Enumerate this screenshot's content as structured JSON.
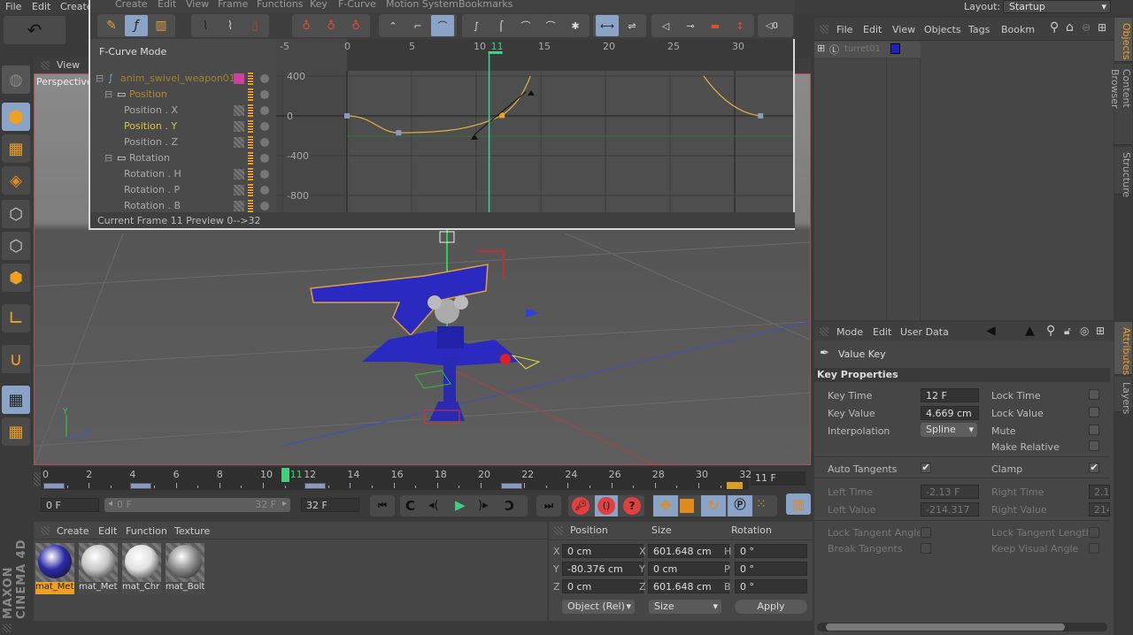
{
  "main_menu": {
    "items": [
      "File",
      "Edit",
      "Create"
    ],
    "layout_label": "Layout:",
    "layout_value": "Startup"
  },
  "fcurve_window": {
    "menu": [
      "Create",
      "Edit",
      "View",
      "Frame",
      "Functions",
      "Key",
      "F-Curve",
      "Motion System",
      "Bookmarks"
    ],
    "mode_label": "F-Curve Mode",
    "tree": [
      {
        "label": "anim_swivel_weapon01",
        "level": 0,
        "type": "root"
      },
      {
        "label": "Position",
        "level": 1,
        "type": "folder"
      },
      {
        "label": "Position . X",
        "level": 2,
        "type": "track"
      },
      {
        "label": "Position . Y",
        "level": 2,
        "type": "track",
        "selected": true
      },
      {
        "label": "Position . Z",
        "level": 2,
        "type": "track"
      },
      {
        "label": "Rotation",
        "level": 1,
        "type": "folder"
      },
      {
        "label": "Rotation . H",
        "level": 2,
        "type": "track"
      },
      {
        "label": "Rotation . P",
        "level": 2,
        "type": "track"
      },
      {
        "label": "Rotation . B",
        "level": 2,
        "type": "track"
      }
    ],
    "x_ticks": [
      "-5",
      "0",
      "5",
      "10",
      "15",
      "20",
      "25",
      "30"
    ],
    "current_frame_marker": "11",
    "y_ticks": [
      "400",
      "0",
      "-400",
      "-800"
    ],
    "status": "Current Frame  11  Preview  0-->32",
    "curve_keys": [
      {
        "frame": 0,
        "value": 0
      },
      {
        "frame": 4,
        "value": -170
      },
      {
        "frame": 12,
        "value": 4.669,
        "selected": true
      },
      {
        "frame": 32,
        "value": 0
      }
    ]
  },
  "viewport": {
    "menu_label": "View",
    "camera_label": "Perspective"
  },
  "objects_panel": {
    "menu": [
      "File",
      "Edit",
      "View",
      "Objects",
      "Tags",
      "Bookm"
    ],
    "object_name": "turret01"
  },
  "right_tabs": {
    "top": [
      "Objects",
      "Content Browser",
      "Structure"
    ],
    "bottom": [
      "Attributes",
      "Layers"
    ]
  },
  "attributes": {
    "menu": [
      "Mode",
      "Edit",
      "User Data"
    ],
    "object_type": "Value Key",
    "section_title": "Key Properties",
    "key_time_label": "Key Time",
    "key_time": "12 F",
    "key_value_label": "Key Value",
    "key_value": "4.669 cm",
    "interpolation_label": "Interpolation",
    "interpolation": "Spline",
    "lock_time_label": "Lock Time",
    "lock_value_label": "Lock Value",
    "mute_label": "Mute",
    "make_relative_label": "Make Relative",
    "auto_tangents_label": "Auto Tangents",
    "auto_tangents": true,
    "clamp_label": "Clamp",
    "clamp": true,
    "left_time_label": "Left Time",
    "left_time": "-2.13 F",
    "left_value_label": "Left Value",
    "left_value": "-214.317",
    "right_time_label": "Right Time",
    "right_time": "2.1",
    "right_value_label": "Right Value",
    "right_value": "214",
    "lock_tangent_angles_label": "Lock Tangent Angles",
    "lock_tangent_lengths_label": "Lock Tangent Lengths",
    "break_tangents_label": "Break Tangents",
    "keep_visual_angle_label": "Keep Visual Angle"
  },
  "timeline": {
    "ticks": [
      "0",
      "2",
      "4",
      "6",
      "8",
      "10",
      "12",
      "14",
      "16",
      "18",
      "20",
      "22",
      "24",
      "26",
      "28",
      "30",
      "32"
    ],
    "current_frame": "11",
    "current_frame_field": "11 F",
    "start_field": "0 F",
    "range_start": "0 F",
    "range_end": "32 F",
    "end_field": "32 F"
  },
  "materials": {
    "menu": [
      "Create",
      "Edit",
      "Function",
      "Texture"
    ],
    "items": [
      {
        "name": "mat_Met",
        "color": "#2a2aa8",
        "selected": true
      },
      {
        "name": "mat_Met",
        "color": "#c8c8c8"
      },
      {
        "name": "mat_Chr",
        "color": "#e0e0e0"
      },
      {
        "name": "mat_Bolt",
        "color": "#8c8c8c"
      }
    ]
  },
  "coordinates": {
    "headers": [
      "Position",
      "Size",
      "Rotation"
    ],
    "position": {
      "X": "0 cm",
      "Y": "-80.376 cm",
      "Z": "0 cm"
    },
    "size": {
      "X": "601.648 cm",
      "Y": "0 cm",
      "Z": "601.648 cm"
    },
    "rotation": {
      "H": "0 °",
      "P": "0 °",
      "B": "0 °"
    },
    "mode_dropdown": "Object (Rel)",
    "size_dropdown": "Size",
    "apply_label": "Apply"
  },
  "branding": "MAXON CINEMA 4D",
  "colors": {
    "accent": "#f0a020",
    "active_button": "#8aa3c7",
    "curve": "#e0b040",
    "playhead": "#40d080"
  }
}
